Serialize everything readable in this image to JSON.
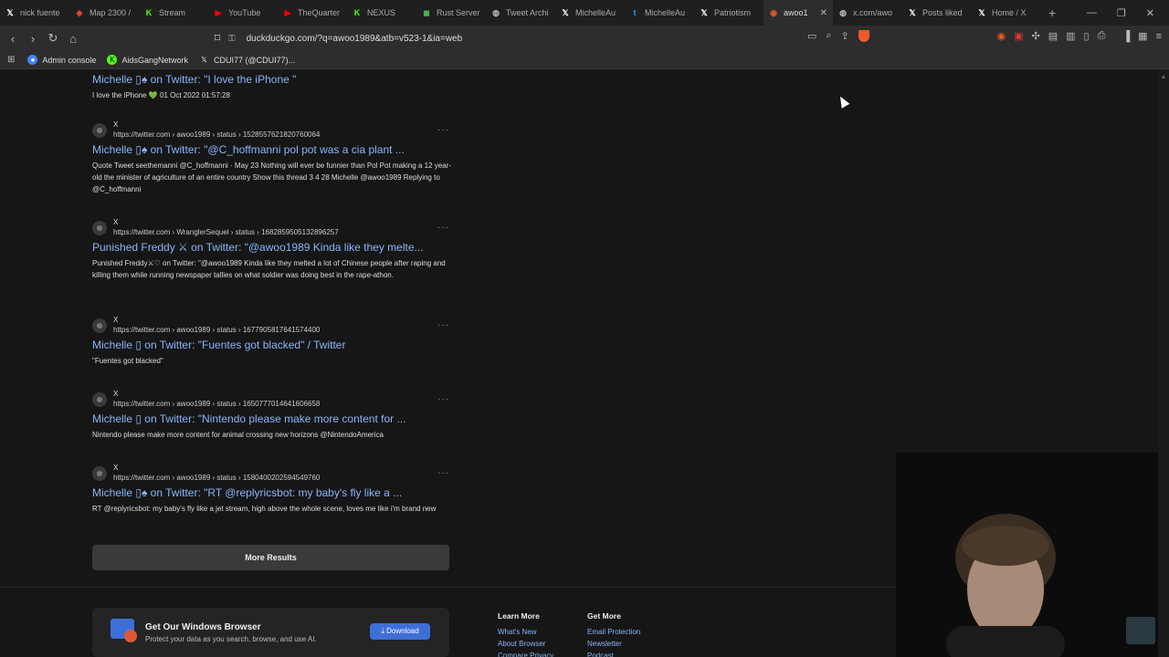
{
  "tabs": [
    {
      "label": "nick fuente",
      "icon": "x-icon",
      "color": "#ffffff"
    },
    {
      "label": "Map 2300 /",
      "icon": "map-pin-icon",
      "color": "#e0443a"
    },
    {
      "label": "Stream",
      "icon": "kick-icon",
      "color": "#53fc18"
    },
    {
      "label": "YouTube",
      "icon": "youtube-icon",
      "color": "#ff0000"
    },
    {
      "label": "TheQuarter",
      "icon": "youtube-icon",
      "color": "#ff0000"
    },
    {
      "label": "NEXUS",
      "icon": "kick-icon",
      "color": "#53fc18"
    },
    {
      "label": "Rust Server",
      "icon": "rust-icon",
      "color": "#4caf50"
    },
    {
      "label": "Tweet Archi",
      "icon": "globe-icon",
      "color": "#bbbbbb"
    },
    {
      "label": "MichelleAu",
      "icon": "x-icon",
      "color": "#ffffff"
    },
    {
      "label": "MichelleAu",
      "icon": "twitter-icon",
      "color": "#1d9bf0"
    },
    {
      "label": "Patriotism",
      "icon": "x-icon",
      "color": "#ffffff"
    },
    {
      "label": "awoo1",
      "icon": "duckduckgo-icon",
      "color": "#de5833"
    },
    {
      "label": "x.com/awo",
      "icon": "globe-icon",
      "color": "#bbbbbb"
    },
    {
      "label": "Posts liked",
      "icon": "x-icon",
      "color": "#ffffff"
    },
    {
      "label": "Home / X",
      "icon": "x-icon",
      "color": "#ffffff"
    }
  ],
  "url": "duckduckgo.com/?q=awoo1989&atb=v523-1&ia=web",
  "bookmarks": [
    {
      "label": "Admin console",
      "icon": "google-icon",
      "color": "#4285f4"
    },
    {
      "label": "AidsGangNetwork",
      "icon": "kick-icon",
      "color": "#53fc18"
    },
    {
      "label": "CDUI77 (@CDUI77)...",
      "icon": "x-icon",
      "color": "#ffffff"
    }
  ],
  "results": [
    {
      "title": "Michelle ▯♠ on Twitter: \"I love the iPhone \"",
      "snippet": "I love the iPhone 💚 01 Oct 2022 01:57:28"
    },
    {
      "site": "X",
      "url": "https://twitter.com › awoo1989 › status › 1528557621820760064",
      "title": "Michelle ▯♠ on Twitter: \"@C_hoffmanni pol pot was a cia plant ...",
      "snippet": "Quote Tweet seethemanni @C_hoffmanni · May 23 Nothing will ever be funnier than Pol Pot making a 12 year-old the minister of agriculture of an entire country Show this thread 3 4 28 Michelle @awoo1989 Replying to @C_hoffmanni"
    },
    {
      "site": "X",
      "url": "https://twitter.com › WranglerSequel › status › 1682859505132896257",
      "title": "Punished Freddy ⚔ on Twitter: \"@awoo1989 Kinda like they melte...",
      "snippet": "Punished Freddy⚔♡ on Twitter: \"@awoo1989 Kinda like they melted a lot of Chinese people after raping and killing them while running newspaper tallies on what soldier was doing best in the rape-athon."
    },
    {
      "site": "X",
      "url": "https://twitter.com › awoo1989 › status › 1677905817641574400",
      "title": "Michelle ▯ on Twitter: \"Fuentes got blacked\" / Twitter",
      "snippet": "\"Fuentes got blacked\""
    },
    {
      "site": "X",
      "url": "https://twitter.com › awoo1989 › status › 1650777014641606658",
      "title": "Michelle ▯ on Twitter: \"Nintendo please make more content for ...",
      "snippet": "Nintendo please make more content for animal crossing new horizons @NintendoAmerica"
    },
    {
      "site": "X",
      "url": "https://twitter.com › awoo1989 › status › 1580400202594549760",
      "title": "Michelle ▯♠ on Twitter: \"RT @replyricsbot: my baby's fly like a ...",
      "snippet": "RT @replyricsbot: my baby's fly like a jet stream, high above the whole scene, loves me like i'm brand new"
    }
  ],
  "more_results": "More Results",
  "promo": {
    "title": "Get Our Windows Browser",
    "subtitle": "Protect your data as you search, browse, and use AI.",
    "button": "Download"
  },
  "footer": {
    "learn_more": {
      "heading": "Learn More",
      "links": [
        "What's New",
        "About Browser",
        "Compare Privacy"
      ]
    },
    "get_more": {
      "heading": "Get More",
      "links": [
        "Email Protection",
        "Newsletter",
        "Podcast"
      ]
    }
  },
  "menu_dots": "···"
}
